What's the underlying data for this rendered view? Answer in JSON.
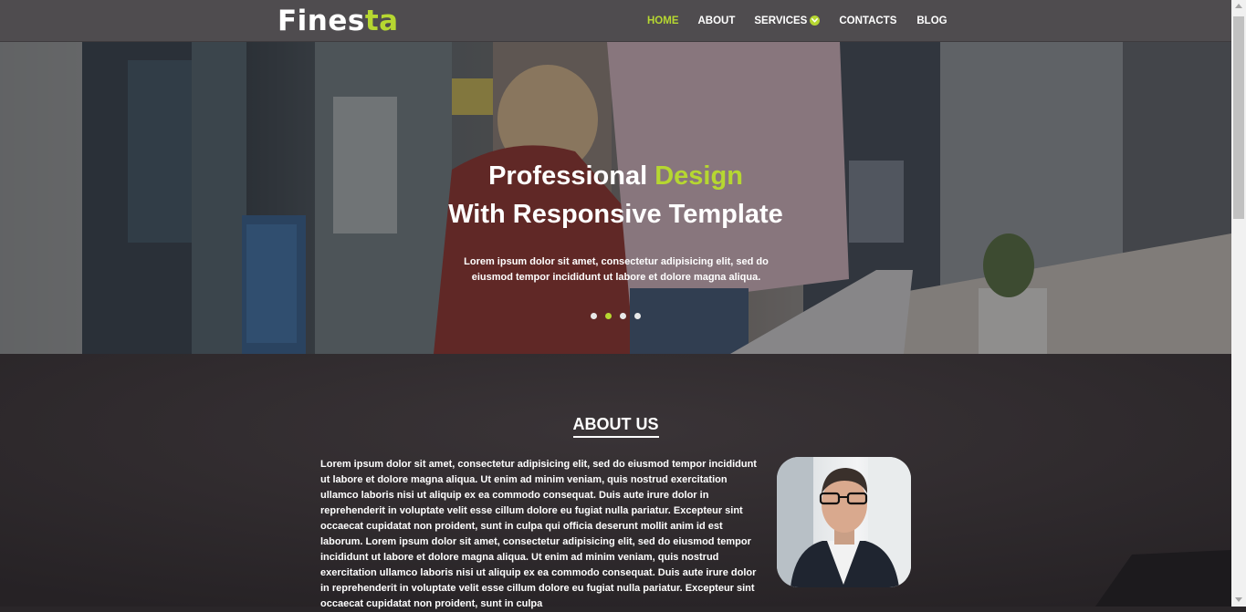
{
  "brand": {
    "logo_main": "Fines",
    "logo_accent": "ta"
  },
  "nav": {
    "home": "HOME",
    "about": "ABOUT",
    "services": "SERVICES",
    "contacts": "CONTACTS",
    "blog": "BLOG",
    "active_item": "HOME"
  },
  "hero": {
    "title_part1": "Professional",
    "title_accent": "Design",
    "title_line2": "With Responsive Template",
    "subtitle": "Lorem ipsum dolor sit amet, consectetur adipisicing elit, sed do eiusmod tempor incididunt ut labore et dolore magna aliqua.",
    "slide_count": 4,
    "active_slide": 2
  },
  "about": {
    "heading": "ABOUT US",
    "body": "Lorem ipsum dolor sit amet, consectetur adipisicing elit, sed do eiusmod tempor incididunt ut labore et dolore magna aliqua. Ut enim ad minim veniam, quis nostrud exercitation ullamco laboris nisi ut aliquip ex ea commodo consequat. Duis aute irure dolor in reprehenderit in voluptate velit esse cillum dolore eu fugiat nulla pariatur. Excepteur sint occaecat cupidatat non proident, sunt in culpa qui officia deserunt mollit anim id est laborum. Lorem ipsum dolor sit amet, consectetur adipisicing elit, sed do eiusmod tempor incididunt ut labore et dolore magna aliqua. Ut enim ad minim veniam, quis nostrud exercitation ullamco laboris nisi ut aliquip ex ea commodo consequat. Duis aute irure dolor in reprehenderit in voluptate velit esse cillum dolore eu fugiat nulla pariatur. Excepteur sint occaecat cupidatat non proident, sunt in culpa"
  },
  "colors": {
    "accent": "#b6d731",
    "header_bg": "#4f4c4f",
    "page_bg": "#2a2629",
    "text": "#ffffff"
  },
  "icons": {
    "services_dropdown": "chevron-down-icon"
  }
}
